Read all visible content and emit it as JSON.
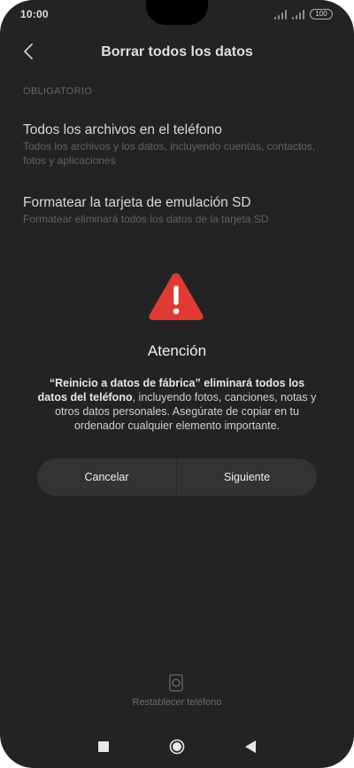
{
  "status_bar": {
    "time": "10:00",
    "battery": "100"
  },
  "header": {
    "title": "Borrar todos los datos"
  },
  "section_label": "OBLIGATORIO",
  "items": [
    {
      "title": "Todos los archivos en el teléfono",
      "description": "Todos los archivos y los datos, incluyendo cuentas, contactos, fotos y aplicaciones"
    },
    {
      "title": "Formatear la tarjeta de emulación SD",
      "description": "Formatear eliminará todos los datos de la tarjeta SD"
    }
  ],
  "dialog": {
    "icon": "warning-triangle-icon",
    "title": "Atención",
    "message_bold_1": "“Reinicio a datos de fábrica” eliminará todos los datos del teléfono",
    "message_rest": ", incluyendo fotos, canciones, notas y otros datos personales. Asegúrate de copiar en tu ordenador cualquier elemento importante.",
    "cancel_label": "Cancelar",
    "next_label": "Siguiente"
  },
  "bottom_action": {
    "label": "Restablecer teléfono",
    "icon": "reset-phone-icon"
  },
  "colors": {
    "background": "#262626",
    "warning_red": "#e03a32",
    "button_bg": "#333333"
  }
}
